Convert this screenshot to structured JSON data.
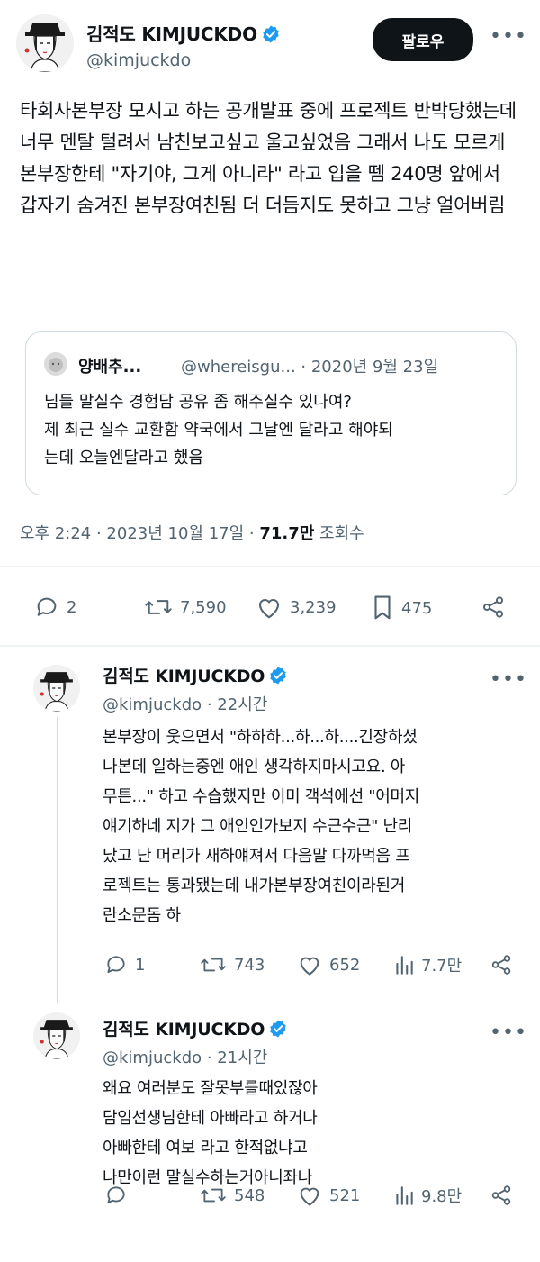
{
  "tweet": {
    "author_name": "김적도 KIMJUCKDO",
    "handle": "@kimjuckdo",
    "follow_label": "팔로우",
    "text": "타회사본부장 모시고 하는 공개발표 중에 프로젝트 반박당했는데 너무 멘탈 털려서 남친보고싶고 울고싶었음 그래서 나도 모르게 본부장한테 \"자기야, 그게 아니라\" 라고 입을 뗌 240명 앞에서 갑자기 숨겨진 본부장여친됨  더 더듬지도 못하고 그냥 얼어버림",
    "quote": {
      "name": "양배추...",
      "handle": "@whereisgu...",
      "date": "· 2020년 9월 23일",
      "lines": [
        "님들 말실수 경험담 공유 좀 해주실수 있나여?",
        "제 최근 실수 교환함 약국에서 그날엔 달라고 해야되",
        "는데 오늘엔달라고 했음"
      ]
    },
    "timestamp": "오후 2:24 · 2023년 10월 17일 · ",
    "views": "71.7만",
    "views_label": " 조회수",
    "stats": {
      "replies": "2",
      "retweets": "7,590",
      "likes": "3,239",
      "bookmarks": "475"
    }
  },
  "replies": [
    {
      "author_name": "김적도 KIMJUCKDO",
      "handle": "@kimjuckdo",
      "time": " · 22시간",
      "lines": [
        "본부장이 웃으면서 \"하하하...하...하....긴장하셨",
        "나본데 일하는중엔 애인 생각하지마시고요. 아",
        "무튼...\" 하고 수습했지만 이미 객석에선 \"어머지",
        "얘기하네 지가 그 애인인가보지 수근수근\" 난리",
        "났고 난 머리가 새하얘져서 다음말 다까먹음 프",
        "로젝트는 통과됐는데 내가본부장여친이라된거",
        "란소문돔 하"
      ],
      "stats": {
        "replies": "1",
        "retweets": "743",
        "likes": "652",
        "views": "7.7만"
      }
    },
    {
      "author_name": "김적도 KIMJUCKDO",
      "handle": "@kimjuckdo",
      "time": " · 21시간",
      "lines": [
        "왜요 여러분도 잘못부를때있잖아",
        "담임선생님한테 아빠라고 하거나",
        "아빠한테 여보 라고 한적없냐고",
        "나만이런 말실수하는거아니좌나"
      ],
      "stats": {
        "replies": "",
        "retweets": "548",
        "likes": "521",
        "views": "9.8만"
      }
    }
  ],
  "icons": {
    "verified": "verified-badge-icon",
    "more": "more-icon",
    "reply": "reply-icon",
    "retweet": "retweet-icon",
    "like": "like-icon",
    "bookmark": "bookmark-icon",
    "views": "views-icon",
    "share": "share-icon"
  },
  "colors": {
    "verified": "#1d9bf0",
    "text": "#0f1419",
    "secondary": "#536471",
    "border": "#cfd9de"
  }
}
